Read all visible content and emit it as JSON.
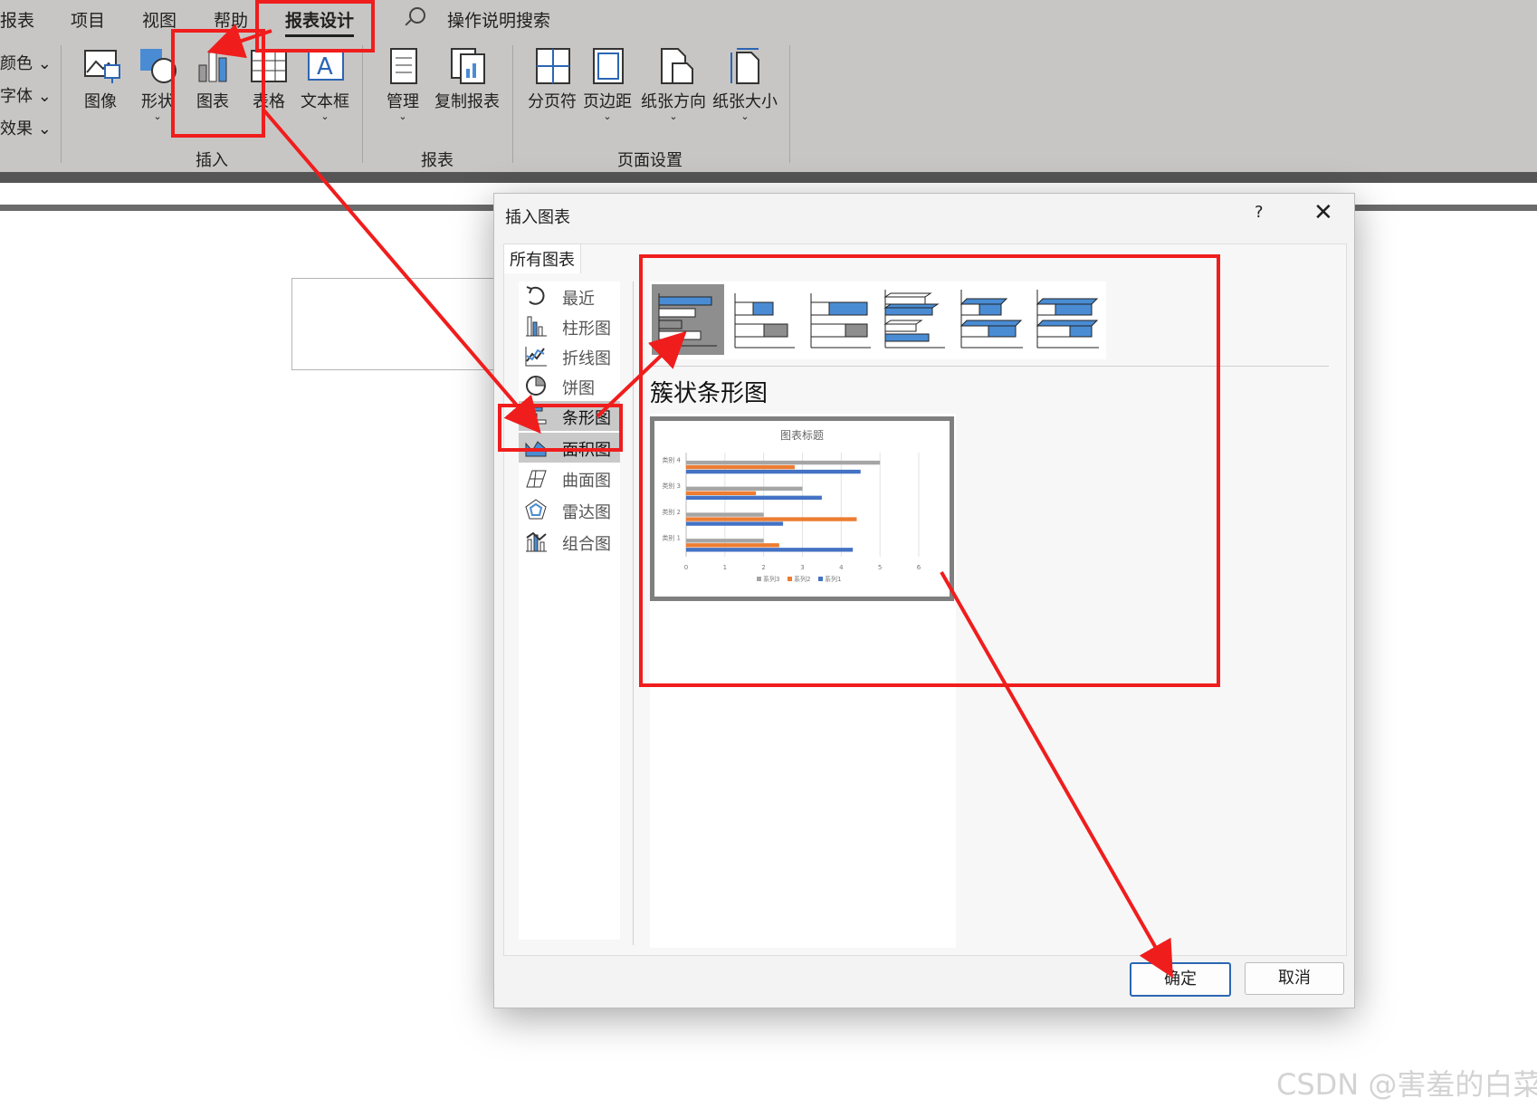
{
  "ribbon": {
    "tabs": [
      "报表",
      "项目",
      "视图",
      "帮助",
      "报表设计"
    ],
    "search_label": "操作说明搜索",
    "left_tools": [
      "颜色",
      "字体",
      "效果"
    ],
    "insert_buttons": [
      "图像",
      "形状",
      "图表",
      "表格",
      "文本框"
    ],
    "report_buttons": [
      "管理",
      "复制报表"
    ],
    "page_buttons": [
      "分页符",
      "页边距",
      "纸张方向",
      "纸张大小"
    ],
    "groups": [
      "插入",
      "报表",
      "页面设置"
    ]
  },
  "dialog": {
    "title": "插入图表",
    "help": "?",
    "close": "✕",
    "tab": "所有图表",
    "categories": [
      "最近",
      "柱形图",
      "折线图",
      "饼图",
      "条形图",
      "面积图",
      "曲面图",
      "雷达图",
      "组合图"
    ],
    "selected_category": "条形图",
    "subtype_name": "簇状条形图",
    "ok_label": "确定",
    "cancel_label": "取消"
  },
  "chart_data": {
    "type": "bar",
    "title": "图表标题",
    "categories": [
      "类别 1",
      "类别 2",
      "类别 3",
      "类别 4"
    ],
    "series": [
      {
        "name": "系列1",
        "values": [
          4.3,
          2.5,
          3.5,
          4.5
        ],
        "color": "#4472c4"
      },
      {
        "name": "系列2",
        "values": [
          2.4,
          4.4,
          1.8,
          2.8
        ],
        "color": "#ed7d31"
      },
      {
        "name": "系列3",
        "values": [
          2,
          2,
          3,
          5
        ],
        "color": "#a5a5a5"
      }
    ],
    "xlim": [
      0,
      6
    ],
    "xticks": [
      "0",
      "1",
      "2",
      "3",
      "4",
      "5",
      "6"
    ],
    "legend": "bottom",
    "grid": true
  },
  "watermark": "CSDN @害羞的白菜",
  "colors": {
    "annotation": "#f01d1d",
    "accent": "#2b66b3",
    "series_blue": "#4472c4"
  }
}
